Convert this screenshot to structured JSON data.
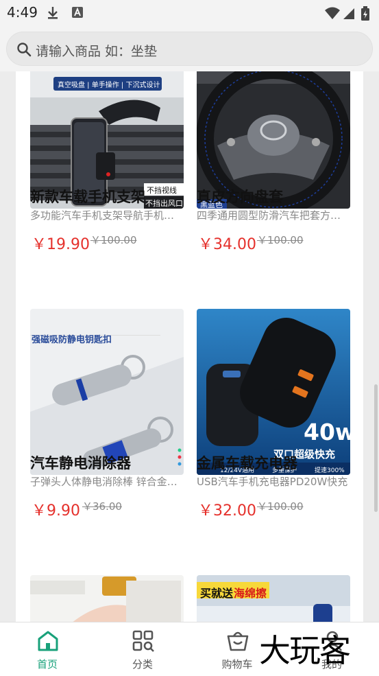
{
  "status_bar": {
    "time": "4:49"
  },
  "search": {
    "placeholder": "请输入商品 如：坐垫"
  },
  "products": [
    {
      "title": "新款车载手机支架",
      "desc": "多功能汽车手机支架导航手机支架",
      "price": "￥19.90",
      "original_price": "￥100.00",
      "image_texts": [
        "真空吸盘 | 单手操作 | 下沉式设计",
        "不挡视线",
        "不挡出风口"
      ]
    },
    {
      "title": "真皮方向盘套",
      "desc": "四季通用圆型防滑汽车把套方向盘套",
      "price": "￥34.00",
      "original_price": "￥100.00",
      "image_texts": [
        "黑蓝色"
      ]
    },
    {
      "title": "汽车静电消除器",
      "desc": "子弹头人体静电消除棒 锌合金钥匙扣",
      "price": "￥9.90",
      "original_price": "￥36.00",
      "image_texts": [
        "强磁吸防静电钥匙扣"
      ]
    },
    {
      "title": "金属车载充电器",
      "desc": "USB汽车手机充电器PD20W快充",
      "price": "￥32.00",
      "original_price": "￥100.00",
      "image_texts": [
        "40w",
        "双口超级快充",
        "12/24V通用",
        "多重保护",
        "提速300%"
      ]
    },
    {
      "image_texts": []
    },
    {
      "image_texts": [
        "买就送",
        "海绵擦"
      ]
    }
  ],
  "tabbar": [
    {
      "label": "首页",
      "icon": "home-icon",
      "active": true
    },
    {
      "label": "分类",
      "icon": "category-grid-icon",
      "active": false
    },
    {
      "label": "购物车",
      "icon": "shopping-basket-icon",
      "active": false
    },
    {
      "label": "我的",
      "icon": "profile-icon",
      "active": false
    }
  ],
  "watermark": "大玩客",
  "colors": {
    "accent": "#18a17a",
    "price": "#e5312c"
  }
}
